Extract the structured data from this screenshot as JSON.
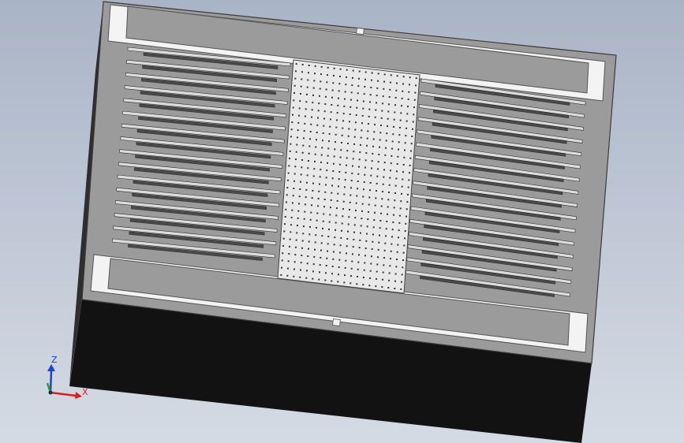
{
  "colors": {
    "background_top": "#a9b4c6",
    "background_bottom": "#d5dbe4",
    "top_face": "#9b9b9b",
    "top_face_edge": "#3b3b3b",
    "front_face": "#121212",
    "left_face": "#2e2e2e",
    "bar_white": "#f3f3f3",
    "finger_dark": "#4a4a4a",
    "finger_light": "#dcdcdc",
    "center_plate": "#e8e8e8",
    "hole": "#333333",
    "axis_x": "#d62020",
    "axis_y": "#2a9c2a",
    "axis_z": "#2040d0"
  },
  "viewport": {
    "view_name": "trimetric-view",
    "part": "comb-drive-mems-structure"
  },
  "triad": {
    "x_label": "X",
    "z_label": "Z"
  },
  "structure": {
    "finger_pairs_per_side": 16,
    "hole_columns": 20,
    "hole_rows": 30
  }
}
